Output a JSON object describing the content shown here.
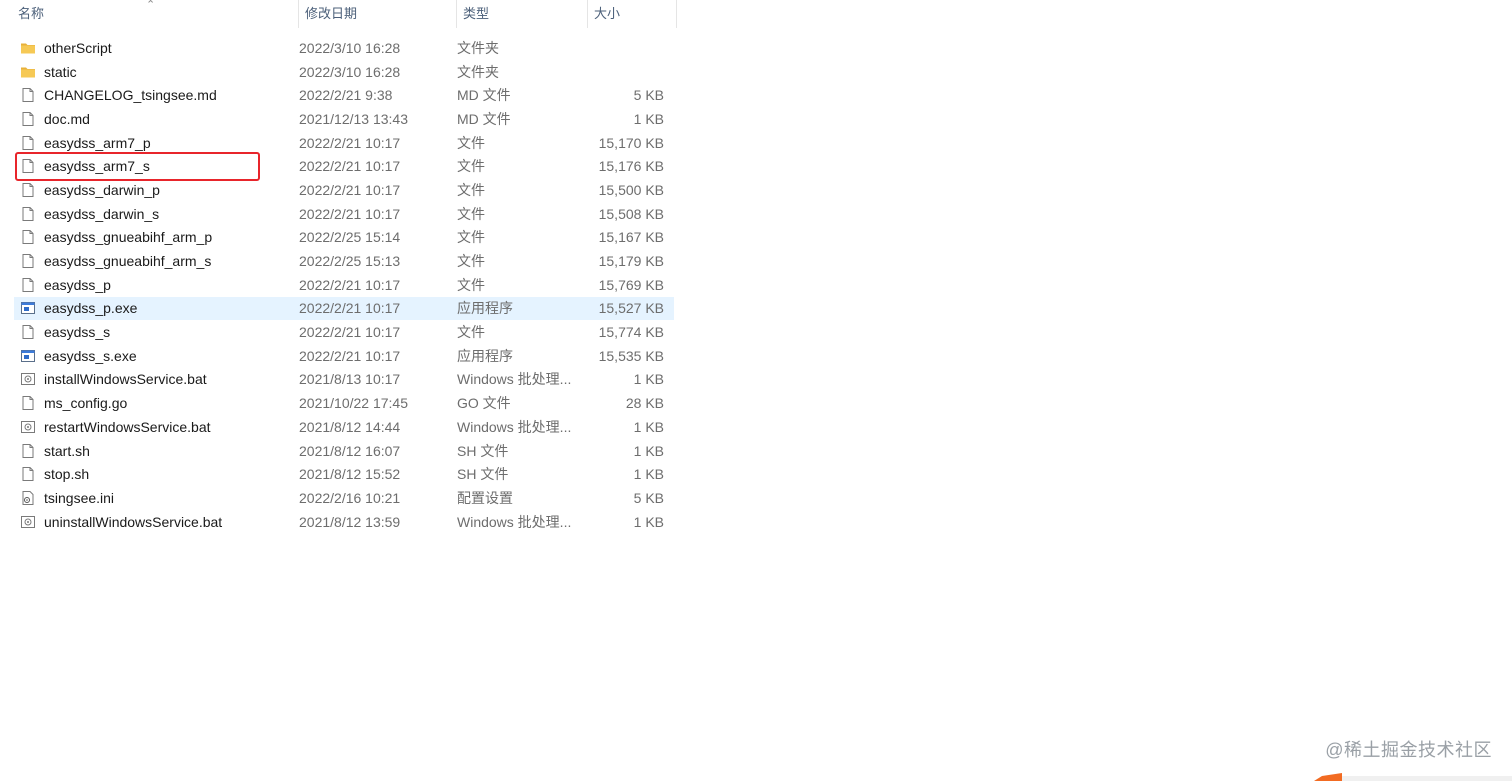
{
  "columns": {
    "name": "名称",
    "date": "修改日期",
    "type": "类型",
    "size": "大小"
  },
  "files": [
    {
      "name": "otherScript",
      "date": "2022/3/10 16:28",
      "type": "文件夹",
      "size": "",
      "icon": "folder-icon"
    },
    {
      "name": "static",
      "date": "2022/3/10 16:28",
      "type": "文件夹",
      "size": "",
      "icon": "folder-icon"
    },
    {
      "name": "CHANGELOG_tsingsee.md",
      "date": "2022/2/21 9:38",
      "type": "MD 文件",
      "size": "5 KB",
      "icon": "file-icon"
    },
    {
      "name": "doc.md",
      "date": "2021/12/13 13:43",
      "type": "MD 文件",
      "size": "1 KB",
      "icon": "file-icon"
    },
    {
      "name": "easydss_arm7_p",
      "date": "2022/2/21 10:17",
      "type": "文件",
      "size": "15,170 KB",
      "icon": "file-icon"
    },
    {
      "name": "easydss_arm7_s",
      "date": "2022/2/21 10:17",
      "type": "文件",
      "size": "15,176 KB",
      "icon": "file-icon"
    },
    {
      "name": "easydss_darwin_p",
      "date": "2022/2/21 10:17",
      "type": "文件",
      "size": "15,500 KB",
      "icon": "file-icon"
    },
    {
      "name": "easydss_darwin_s",
      "date": "2022/2/21 10:17",
      "type": "文件",
      "size": "15,508 KB",
      "icon": "file-icon"
    },
    {
      "name": "easydss_gnueabihf_arm_p",
      "date": "2022/2/25 15:14",
      "type": "文件",
      "size": "15,167 KB",
      "icon": "file-icon"
    },
    {
      "name": "easydss_gnueabihf_arm_s",
      "date": "2022/2/25 15:13",
      "type": "文件",
      "size": "15,179 KB",
      "icon": "file-icon"
    },
    {
      "name": "easydss_p",
      "date": "2022/2/21 10:17",
      "type": "文件",
      "size": "15,769 KB",
      "icon": "file-icon"
    },
    {
      "name": "easydss_p.exe",
      "date": "2022/2/21 10:17",
      "type": "应用程序",
      "size": "15,527 KB",
      "icon": "exe-icon"
    },
    {
      "name": "easydss_s",
      "date": "2022/2/21 10:17",
      "type": "文件",
      "size": "15,774 KB",
      "icon": "file-icon"
    },
    {
      "name": "easydss_s.exe",
      "date": "2022/2/21 10:17",
      "type": "应用程序",
      "size": "15,535 KB",
      "icon": "exe-icon"
    },
    {
      "name": "installWindowsService.bat",
      "date": "2021/8/13 10:17",
      "type": "Windows 批处理...",
      "size": "1 KB",
      "icon": "bat-icon"
    },
    {
      "name": "ms_config.go",
      "date": "2021/10/22 17:45",
      "type": "GO 文件",
      "size": "28 KB",
      "icon": "file-icon"
    },
    {
      "name": "restartWindowsService.bat",
      "date": "2021/8/12 14:44",
      "type": "Windows 批处理...",
      "size": "1 KB",
      "icon": "bat-icon"
    },
    {
      "name": "start.sh",
      "date": "2021/8/12 16:07",
      "type": "SH 文件",
      "size": "1 KB",
      "icon": "file-icon"
    },
    {
      "name": "stop.sh",
      "date": "2021/8/12 15:52",
      "type": "SH 文件",
      "size": "1 KB",
      "icon": "file-icon"
    },
    {
      "name": "tsingsee.ini",
      "date": "2022/2/16 10:21",
      "type": "配置设置",
      "size": "5 KB",
      "icon": "ini-icon"
    },
    {
      "name": "uninstallWindowsService.bat",
      "date": "2021/8/12 13:59",
      "type": "Windows 批处理...",
      "size": "1 KB",
      "icon": "bat-icon"
    }
  ],
  "selected_file": "easydss_p.exe",
  "highlighted_file": "easydss_arm7_s",
  "watermark": "@稀土掘金技术社区",
  "colors": {
    "selection": "#e5f3ff",
    "highlight_border": "#e8252b",
    "folder": "#f3c04a",
    "corner_accent": "#f26b22"
  }
}
